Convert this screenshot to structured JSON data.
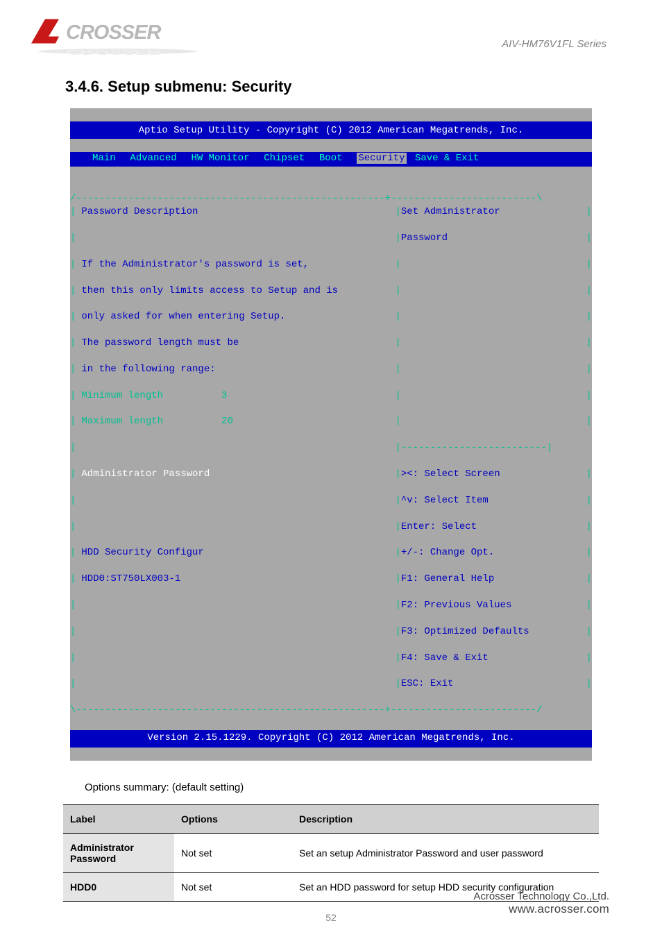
{
  "logo_alt": "ACROSSER",
  "doc_title": "AIV-HM76V1FL Series",
  "section_title": "3.4.6. Setup submenu: Security",
  "bios": {
    "header": "Aptio Setup Utility - Copyright (C) 2012 American Megatrends, Inc.",
    "tabs": [
      "Main",
      "Advanced",
      "HW Monitor",
      "Chipset",
      "Boot",
      "Security",
      "Save & Exit"
    ],
    "active_tab": "Security",
    "left_lines": [
      "Password Description",
      "",
      "If the Administrator's password is set,",
      "then this only limits access to Setup and is",
      "only asked for when entering Setup.",
      "The password length must be",
      "in the following range:",
      "Minimum length          3",
      "Maximum length          20",
      "",
      "Administrator Password",
      "",
      "",
      "HDD Security Configur",
      "HDD0:ST750LX003-1",
      "",
      "",
      "",
      ""
    ],
    "right_top": [
      "Set Administrator",
      "Password"
    ],
    "right_help": [
      "><: Select Screen",
      "^v: Select Item",
      "Enter: Select",
      "+/-: Change Opt.",
      "F1: General Help",
      "F2: Previous Values",
      "F3: Optimized Defaults",
      "F4: Save & Exit",
      "ESC: Exit"
    ],
    "footer": "Version 2.15.1229. Copyright (C) 2012 American Megatrends, Inc."
  },
  "desc_line": "Options summary: (default setting)",
  "table": {
    "h1": "Label",
    "h2": "Options",
    "h3": "Description",
    "r1": {
      "label": "Administrator Password",
      "opt": "Not set",
      "desc": "Set an setup Administrator Password and user password"
    },
    "r2": {
      "label": "HDD0",
      "opt": "Not set",
      "desc": "Set an HDD password for setup HDD security configuration"
    }
  },
  "footer": {
    "company": "Acrosser Technology Co.,Ltd.",
    "url": "www.acrosser.com",
    "page": "52"
  }
}
